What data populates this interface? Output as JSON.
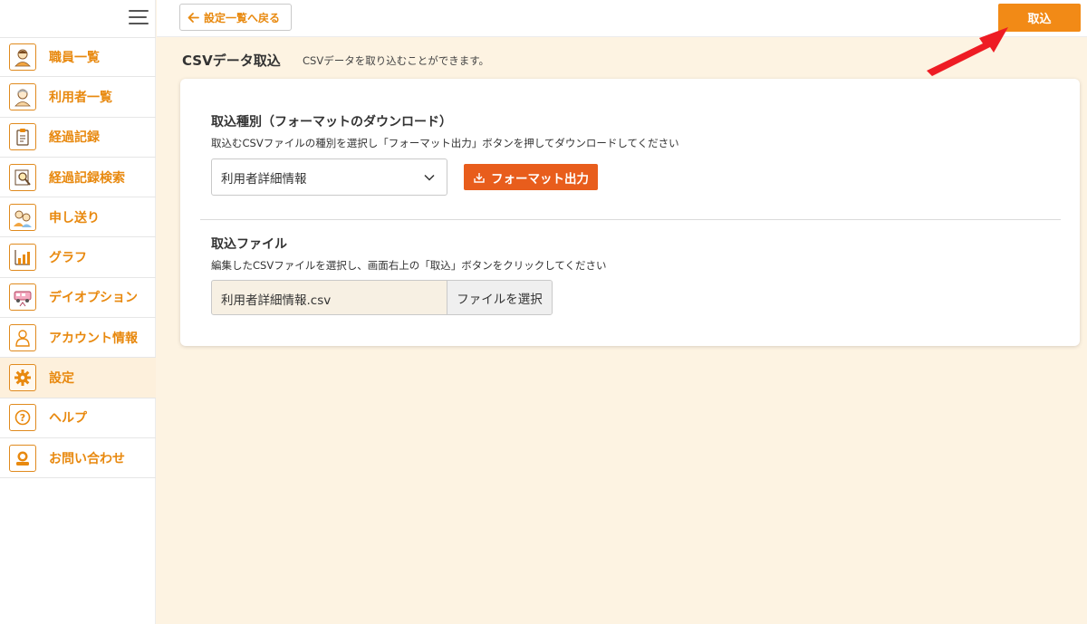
{
  "topbar": {
    "back_label": "設定一覧へ戻る",
    "import_label": "取込"
  },
  "sidebar": {
    "items": [
      {
        "label": "職員一覧",
        "icon": "staff-icon"
      },
      {
        "label": "利用者一覧",
        "icon": "user-list-icon"
      },
      {
        "label": "経過記録",
        "icon": "clipboard-icon"
      },
      {
        "label": "経過記録検索",
        "icon": "search-record-icon"
      },
      {
        "label": "申し送り",
        "icon": "handover-icon"
      },
      {
        "label": "グラフ",
        "icon": "graph-icon"
      },
      {
        "label": "デイオプション",
        "icon": "day-option-icon"
      },
      {
        "label": "アカウント情報",
        "icon": "account-icon"
      },
      {
        "label": "設定",
        "icon": "gear-icon"
      },
      {
        "label": "ヘルプ",
        "icon": "help-icon"
      },
      {
        "label": "お問い合わせ",
        "icon": "contact-icon"
      }
    ]
  },
  "page": {
    "title": "CSVデータ取込",
    "description": "CSVデータを取り込むことができます。"
  },
  "format_section": {
    "title": "取込種別（フォーマットのダウンロード）",
    "description": "取込むCSVファイルの種別を選択し「フォーマット出力」ボタンを押してダウンロードしてください",
    "selected": "利用者詳細情報",
    "button_label": "フォーマット出力"
  },
  "file_section": {
    "title": "取込ファイル",
    "description": "編集したCSVファイルを選択し、画面右上の「取込」ボタンをクリックしてください",
    "file_name": "利用者詳細情報.csv",
    "button_label": "ファイルを選択"
  },
  "colors": {
    "accent": "#e8890f",
    "import_button": "#f28a16",
    "format_button": "#e85d1c",
    "background": "#fdf3e2",
    "arrow": "#ee1c24"
  }
}
